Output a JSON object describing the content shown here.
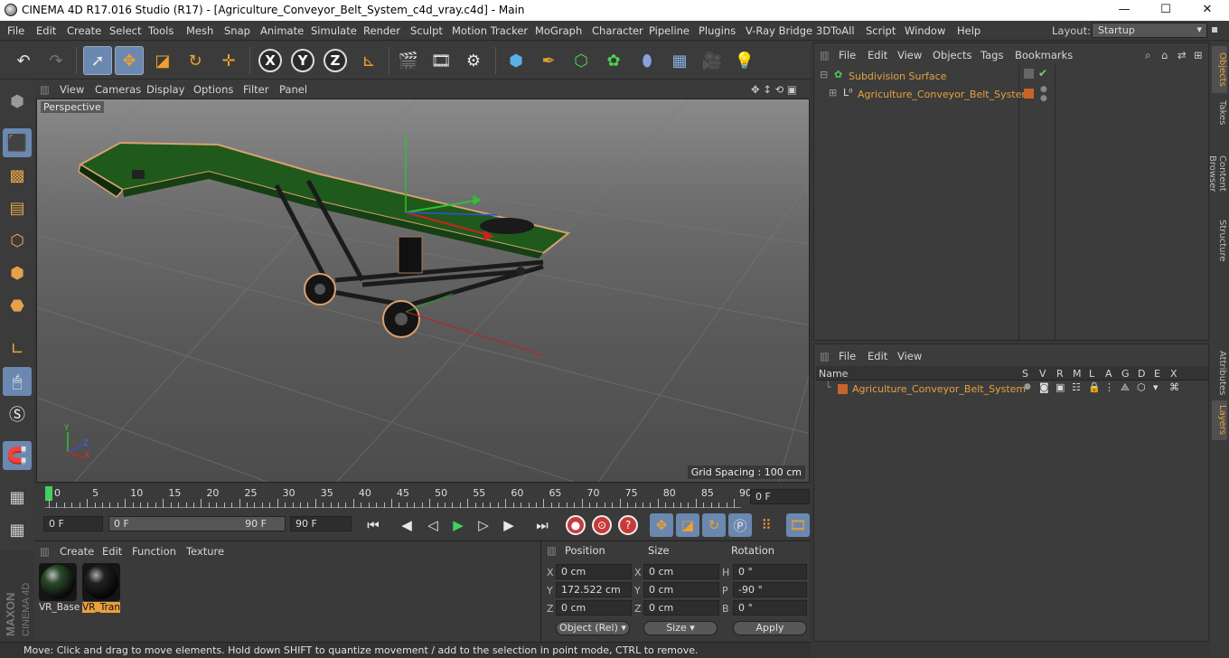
{
  "window": {
    "title": "CINEMA 4D R17.016 Studio (R17) - [Agriculture_Conveyor_Belt_System_c4d_vray.c4d] - Main",
    "minimize": "—",
    "maximize": "☐",
    "close": "✕"
  },
  "menubar": {
    "items": [
      "File",
      "Edit",
      "Create",
      "Select",
      "Tools",
      "Mesh",
      "Snap",
      "Animate",
      "Simulate",
      "Render",
      "Sculpt",
      "Motion Tracker",
      "MoGraph",
      "Character",
      "Pipeline",
      "Plugins",
      "V-Ray Bridge",
      "3DToAll",
      "Script",
      "Window",
      "Help"
    ],
    "layout_label": "Layout:",
    "layout_value": "Startup"
  },
  "toolbar": {
    "icons": [
      "undo-icon",
      "redo-icon",
      "live-selection-icon",
      "move-icon",
      "scale-icon",
      "rotate-icon",
      "recent-tool-icon",
      "x-axis-icon",
      "y-axis-icon",
      "z-axis-icon",
      "coordinate-system-icon",
      "render-view-icon",
      "render-picture-viewer-icon",
      "render-settings-icon",
      "cube-primitive-icon",
      "pen-spline-icon",
      "subdivision-icon",
      "cloner-icon",
      "deformer-icon",
      "floor-icon",
      "camera-icon",
      "light-icon"
    ],
    "axis_labels": [
      "X",
      "Y",
      "Z"
    ]
  },
  "left_toolbar": {
    "icons": [
      "make-editable-icon",
      "model-mode-icon",
      "texture-mode-icon",
      "workplane-icon",
      "points-mode-icon",
      "edges-mode-icon",
      "polygons-mode-icon",
      "axis-mode-icon",
      "tweak-mode-icon",
      "solo-icon",
      "snap-icon",
      "workplane-lock-icon",
      "planar-workplane-icon"
    ]
  },
  "viewport": {
    "menu": [
      "View",
      "Cameras",
      "Display",
      "Options",
      "Filter",
      "Panel"
    ],
    "label": "Perspective",
    "grid_spacing": "Grid Spacing : 100 cm",
    "axis_x": "X",
    "axis_y": "Y",
    "axis_z": "Z"
  },
  "timeline": {
    "ticks": [
      "0",
      "5",
      "10",
      "15",
      "20",
      "25",
      "30",
      "35",
      "40",
      "45",
      "50",
      "55",
      "60",
      "65",
      "70",
      "75",
      "80",
      "85",
      "90"
    ],
    "current_frame": "0 F",
    "current_value": 0
  },
  "playback": {
    "start": "0 F",
    "range_start": "0 F",
    "range_end": "90 F",
    "end": "90 F"
  },
  "material_panel": {
    "menu": [
      "Create",
      "Edit",
      "Function",
      "Texture"
    ],
    "materials": [
      {
        "name": "VR_Base",
        "selected": false
      },
      {
        "name": "VR_Tran",
        "selected": true
      }
    ]
  },
  "coordinates": {
    "headers": {
      "position": "Position",
      "size": "Size",
      "rotation": "Rotation"
    },
    "rows": [
      {
        "axis": "X",
        "pos": "0 cm",
        "size_axis": "X",
        "size": "0 cm",
        "rot_axis": "H",
        "rot": "0 °"
      },
      {
        "axis": "Y",
        "pos": "172.522 cm",
        "size_axis": "Y",
        "size": "0 cm",
        "rot_axis": "P",
        "rot": "-90 °"
      },
      {
        "axis": "Z",
        "pos": "0 cm",
        "size_axis": "Z",
        "size": "0 cm",
        "rot_axis": "B",
        "rot": "0 °"
      }
    ],
    "mode": "Object (Rel)",
    "size_mode": "Size",
    "apply": "Apply"
  },
  "status": "Move: Click and drag to move elements. Hold down SHIFT to quantize movement / add to the selection in point mode, CTRL to remove.",
  "object_manager": {
    "menu": [
      "File",
      "Edit",
      "View",
      "Objects",
      "Tags",
      "Bookmarks"
    ],
    "objects": [
      {
        "name": "Subdivision Surface",
        "color": "#e8a040"
      },
      {
        "name": "Agriculture_Conveyor_Belt_System",
        "color": "#e8a040",
        "tag_color": "#c86428"
      }
    ]
  },
  "layer_manager": {
    "menu": [
      "File",
      "Edit",
      "View"
    ],
    "columns": [
      "Name",
      "S",
      "V",
      "R",
      "M",
      "L",
      "A",
      "G",
      "D",
      "E",
      "X"
    ],
    "layers": [
      {
        "name": "Agriculture_Conveyor_Belt_System",
        "color": "#c86428"
      }
    ]
  },
  "right_tabs": [
    "Objects",
    "Takes",
    "Content Browser",
    "Structure",
    "Attributes",
    "Layers"
  ],
  "brand": {
    "line1": "MAXON",
    "line2": "CINEMA 4D"
  }
}
